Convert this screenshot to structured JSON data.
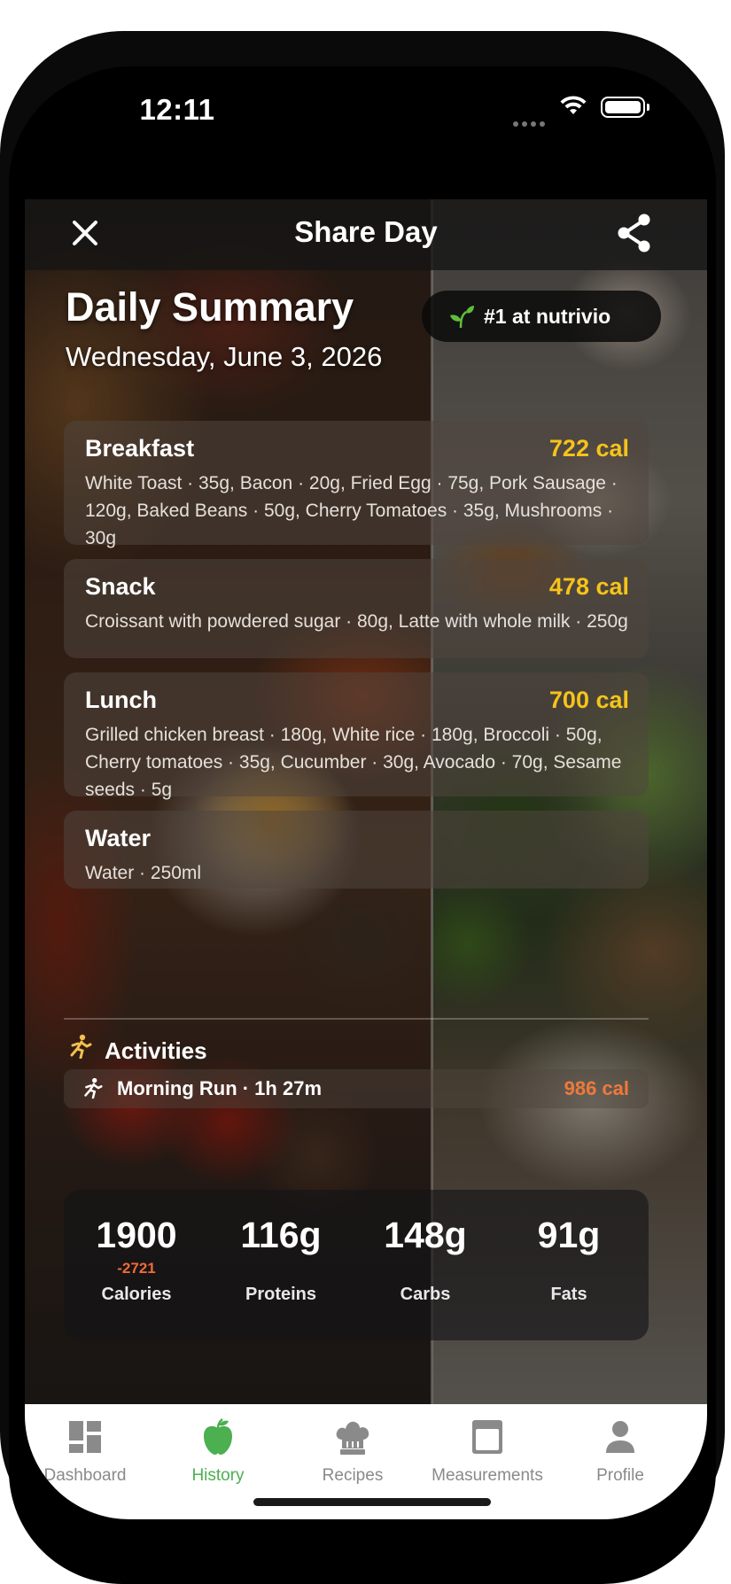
{
  "status_bar": {
    "time": "12:11"
  },
  "header": {
    "title": "Share Day"
  },
  "summary": {
    "title": "Daily Summary",
    "date": "Wednesday, June 3, 2026",
    "badge": "#1 at nutrivio"
  },
  "meals": [
    {
      "name": "Breakfast",
      "calories": "722 cal",
      "items": "White Toast · 35g, Bacon · 20g, Fried Egg · 75g, Pork Sausage · 120g, Baked Beans · 50g, Cherry Tomatoes · 35g, Mushrooms · 30g"
    },
    {
      "name": "Snack",
      "calories": "478 cal",
      "items": "Croissant with powdered sugar · 80g, Latte with whole milk · 250g"
    },
    {
      "name": "Lunch",
      "calories": "700 cal",
      "items": "Grilled chicken breast · 180g, White rice · 180g, Broccoli · 50g, Cherry tomatoes · 35g, Cucumber · 30g, Avocado · 70g, Sesame seeds · 5g"
    },
    {
      "name": "Water",
      "calories": "",
      "items": "Water · 250ml"
    }
  ],
  "activities": {
    "title": "Activities",
    "items": [
      {
        "name": "Morning Run · 1h 27m",
        "calories": "986 cal"
      }
    ]
  },
  "totals": [
    {
      "value": "1900",
      "sub": "-2721",
      "label": "Calories"
    },
    {
      "value": "116g",
      "sub": "",
      "label": "Proteins"
    },
    {
      "value": "148g",
      "sub": "",
      "label": "Carbs"
    },
    {
      "value": "91g",
      "sub": "",
      "label": "Fats"
    }
  ],
  "tabs": [
    {
      "label": "Dashboard",
      "icon": "dashboard-icon",
      "active": false
    },
    {
      "label": "History",
      "icon": "apple-icon",
      "active": true
    },
    {
      "label": "Recipes",
      "icon": "chef-hat-icon",
      "active": false
    },
    {
      "label": "Measurements",
      "icon": "scale-icon",
      "active": false
    },
    {
      "label": "Profile",
      "icon": "person-icon",
      "active": false
    }
  ],
  "colors": {
    "accent_calories": "#f6c31a",
    "burned_calories": "#ee7a3a",
    "active_tab": "#4caf50",
    "inactive_tab": "#8a8a8a"
  }
}
